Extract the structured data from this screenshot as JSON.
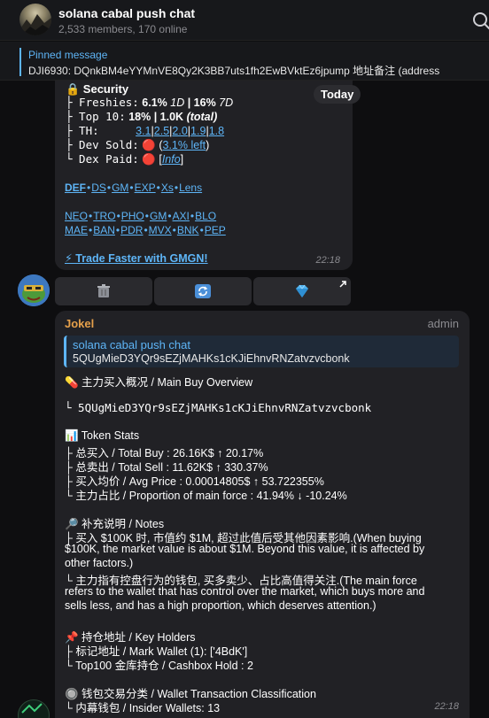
{
  "header": {
    "title": "solana cabal push chat",
    "subtitle": "2,533 members, 170 online"
  },
  "pinned": {
    "label": "Pinned message",
    "text": "DJI6930: DQnkBM4eYYMnVE8Qy2K3BB7uts1fh2EwBVktEz6jpump  地址备注 (address"
  },
  "message1": {
    "security_title": "🔒 Security",
    "fresh_label": "├ Freshies:",
    "fresh_value": "6.1% ",
    "fresh_1d": "1D",
    "fresh_sep": " | 16% ",
    "fresh_7d": "7D",
    "top10_label": "├ Top 10:",
    "top10_value": "18% | 1.0K ",
    "top10_total": "(total)",
    "th_label": "├ TH:",
    "th_values": [
      "3.1",
      "2.5",
      "2.0",
      "1.9",
      "1.8"
    ],
    "dev_sold_label": "├ Dev Sold:",
    "dev_sold_icon": "🔴",
    "dev_sold_link": "3.1% left",
    "dex_paid_label": "└ Dex Paid:",
    "dex_paid_icon": "🔴",
    "dex_paid_link": "Info",
    "links_row1": [
      "DEF",
      "DS",
      "GM",
      "EXP",
      "Xs",
      "Lens"
    ],
    "links_row2": [
      "NEO",
      "TRO",
      "PHO",
      "GM",
      "AXI",
      "BLO"
    ],
    "links_row3": [
      "MAE",
      "BAN",
      "PDR",
      "MVX",
      "BNK",
      "PEP"
    ],
    "trade_link": "⚡ Trade Faster with GMGN!",
    "time": "22:18"
  },
  "date_badge": "Today",
  "keyboard": {
    "buttons": [
      {
        "icon": "trash-icon"
      },
      {
        "icon": "refresh-icon"
      },
      {
        "icon": "diamond-icon"
      }
    ]
  },
  "message2": {
    "sender": "Jokel",
    "role": "admin",
    "reply_title": "solana cabal push chat",
    "reply_text": "5QUgMieD3YQr9sEZjMAHKs1cKJiEhnvRNZatvzvcbonk",
    "lines": [
      "💊 主力买入概况 / Main Buy Overview",
      "└ 5QUgMieD3YQr9sEZjMAHKs1cKJiEhnvRNZatvzvcbonk",
      "📊 Token Stats",
      "├ 总买入 / Total Buy : 26.16K$ ↑ 20.17%",
      "├ 总卖出 / Total Sell : 11.62K$ ↑ 330.37%",
      "├ 买入均价 / Avg Price : 0.00014805$ ↑ 53.722355%",
      "└ 主力占比 / Proportion of main force : 41.94% ↓ -10.24%",
      "🔎 补充说明 / Notes",
      "├ 买入 $100K 时, 市值约 $1M, 超过此值后受其他因素影响.(When buying",
      "$100K, the market value is about $1M. Beyond this value, it is affected by",
      "other factors.)",
      "└ 主力指有控盘行为的钱包, 买多卖少、占比高值得关注.(The main force",
      "refers to the wallet that has control over the market, which buys more and",
      "sells less, and has a high proportion, which deserves attention.)",
      "📌 持仓地址 / Key Holders",
      "├ 标记地址 / Mark Wallet (1): ['4BdK']",
      "└ Top100 金库持仓 / Cashbox Hold : 2",
      "🔘 钱包交易分类 / Wallet Transaction Classification",
      "└ 内幕钱包 / Insider Wallets: 13"
    ],
    "time": "22:18"
  }
}
